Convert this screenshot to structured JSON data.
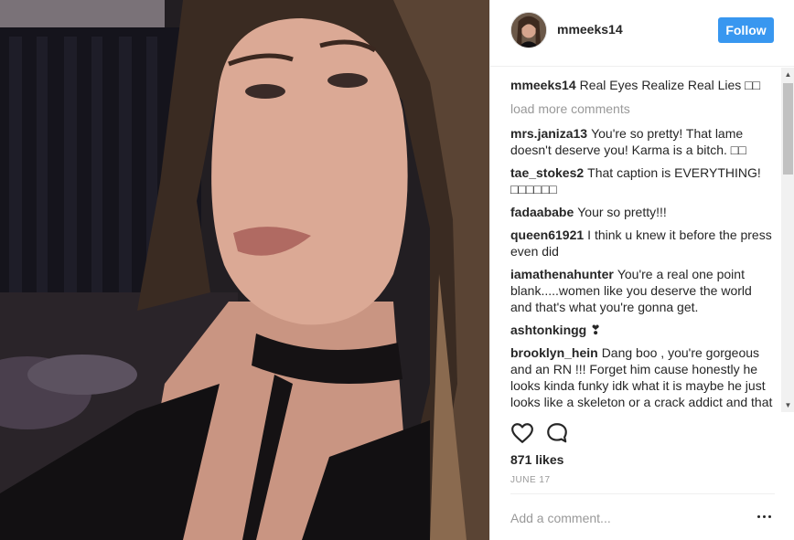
{
  "post": {
    "username": "mmeeks14",
    "follow_label": "Follow",
    "caption_user": "mmeeks14",
    "caption_text": "Real Eyes Realize Real Lies □□",
    "load_more": "load more comments",
    "comments": [
      {
        "user": "mrs.janiza13",
        "text": "You're so pretty! That lame doesn't deserve you! Karma is a bitch. □□"
      },
      {
        "user": "tae_stokes2",
        "text": "That caption is EVERYTHING! □□□□□□"
      },
      {
        "user": "fadaababe",
        "text": "Your so pretty!!!"
      },
      {
        "user": "queen61921",
        "text": "I think u knew it before the press even did"
      },
      {
        "user": "iamathenahunter",
        "text": "You're a real one point blank.....women like you deserve the world and that's what you're gonna get."
      },
      {
        "user": "ashtonkingg",
        "text": "❣"
      },
      {
        "user": "brooklyn_hein",
        "text": "Dang boo , you're gorgeous and an RN !!! Forget him cause honestly he looks kinda funky idk what it is maybe he just looks like a skeleton or a crack addict and that new girl is disgusting and has a"
      }
    ],
    "likes": "871 likes",
    "date": "JUNE 17",
    "add_comment_placeholder": "Add a comment..."
  },
  "icons": {
    "like": "heart-outline-icon",
    "comment": "speech-bubble-icon",
    "more": "ellipsis-icon"
  },
  "colors": {
    "follow_button": "#3897f0",
    "muted_text": "#999999",
    "divider": "#efefef"
  }
}
